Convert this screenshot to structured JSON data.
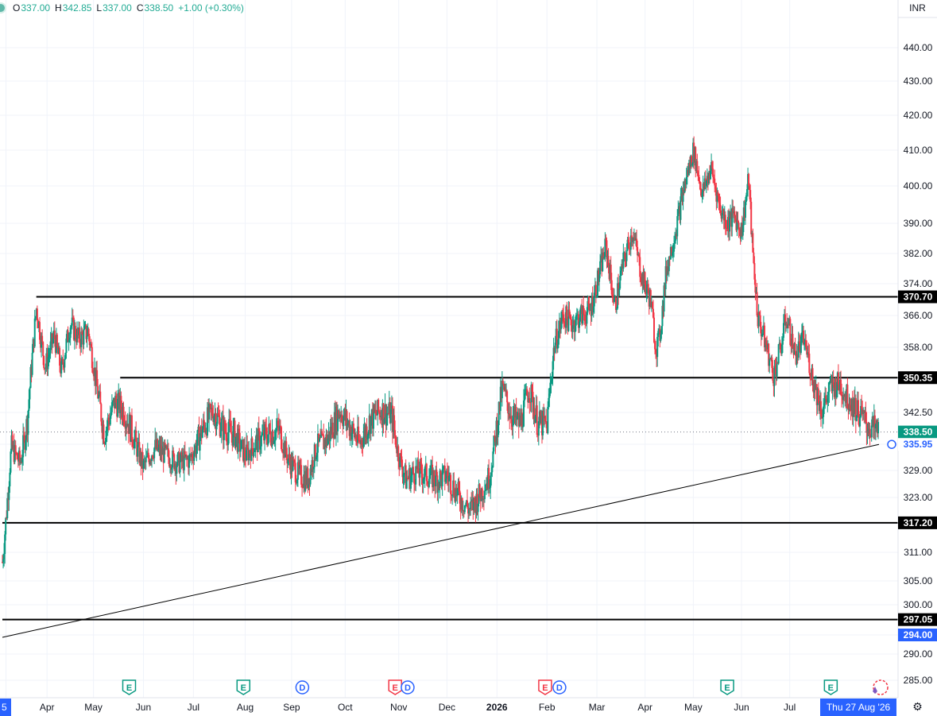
{
  "header": {
    "open_label": "O",
    "open": "337.00",
    "high_label": "H",
    "high": "342.85",
    "low_label": "L",
    "low": "337.00",
    "close_label": "C",
    "close": "338.50",
    "change": "+1.00 (+0.30%)"
  },
  "currency": "INR",
  "settings_icon": "gear-icon",
  "colors": {
    "up": "#089981",
    "down": "#f23645",
    "grid": "#f0f3fa",
    "axis": "#131722",
    "blue": "#2962ff",
    "header_up": "#22ab94"
  },
  "chart_data": {
    "type": "candlestick",
    "ylim": [
      281,
      449
    ],
    "y_ticks": [
      285,
      290,
      294,
      300,
      305,
      311,
      317,
      323,
      329,
      336,
      342.5,
      350,
      358,
      366,
      374,
      382,
      390,
      400,
      410,
      420,
      430,
      440
    ],
    "y_tick_labels": [
      "285.00",
      "290.00",
      "",
      "300.00",
      "305.00",
      "311.00",
      "",
      "323.00",
      "329.00",
      "",
      "342.50",
      "",
      "358.00",
      "366.00",
      "374.00",
      "382.00",
      "390.00",
      "400.00",
      "410.00",
      "420.00",
      "430.00",
      "440.00"
    ],
    "x_labels": [
      "5",
      "Apr",
      "May",
      "Jun",
      "Jul",
      "Aug",
      "Sep",
      "Oct",
      "Nov",
      "Dec",
      "2026",
      "Feb",
      "Mar",
      "Apr",
      "May",
      "Jun",
      "Jul"
    ],
    "x_label_bold": [
      false,
      false,
      false,
      false,
      false,
      false,
      false,
      false,
      false,
      false,
      true,
      false,
      false,
      false,
      false,
      false,
      false
    ],
    "x_label_pos": [
      0.2,
      2.5,
      5.1,
      7.9,
      10.7,
      13.6,
      16.2,
      19.2,
      22.2,
      24.9,
      27.7,
      30.5,
      33.3,
      36.0,
      38.7,
      41.4,
      44.1
    ],
    "x_months": 51.5,
    "horizontal_lines": [
      {
        "price": 370.7,
        "label": "370.70",
        "from": 1.9
      },
      {
        "price": 350.35,
        "label": "350.35",
        "from": 6.6
      },
      {
        "price": 317.2,
        "label": "317.20",
        "from": 0
      },
      {
        "price": 297.05,
        "label": "297.05",
        "from": 0
      }
    ],
    "trendline": {
      "from": [
        0,
        293.5
      ],
      "to": [
        49.1,
        335.95
      ]
    },
    "current_price": {
      "price": 338.5,
      "label": "338.50"
    },
    "trend_price_label": {
      "price": 335.95,
      "label": "335.95"
    },
    "crosshair_price_label": {
      "price": 294.0,
      "label": "294.00"
    },
    "crosshair_date": "Thu 27 Aug '26",
    "events": [
      {
        "x": 7.1,
        "type": "E",
        "color": "green"
      },
      {
        "x": 13.5,
        "type": "E",
        "color": "green"
      },
      {
        "x": 16.8,
        "type": "D",
        "color": "blue"
      },
      {
        "x": 22.0,
        "type": "E",
        "color": "red"
      },
      {
        "x": 22.7,
        "type": "D",
        "color": "blue"
      },
      {
        "x": 30.4,
        "type": "E",
        "color": "red"
      },
      {
        "x": 31.2,
        "type": "D",
        "color": "blue"
      },
      {
        "x": 40.6,
        "type": "E",
        "color": "green"
      },
      {
        "x": 46.4,
        "type": "E",
        "color": "green"
      }
    ],
    "anchors": [
      [
        0,
        309
      ],
      [
        0.2,
        318
      ],
      [
        0.5,
        335
      ],
      [
        1.0,
        331
      ],
      [
        1.4,
        341
      ],
      [
        1.7,
        357
      ],
      [
        1.9,
        368
      ],
      [
        2.4,
        353
      ],
      [
        2.9,
        361
      ],
      [
        3.3,
        352
      ],
      [
        3.8,
        364
      ],
      [
        4.3,
        360
      ],
      [
        4.8,
        362
      ],
      [
        5.3,
        348
      ],
      [
        5.7,
        338
      ],
      [
        6.3,
        345
      ],
      [
        6.8,
        343
      ],
      [
        7.3,
        338
      ],
      [
        7.9,
        330
      ],
      [
        8.5,
        335
      ],
      [
        9.2,
        333
      ],
      [
        9.8,
        331
      ],
      [
        10.5,
        332
      ],
      [
        11.2,
        339
      ],
      [
        11.8,
        343
      ],
      [
        12.4,
        339
      ],
      [
        13.0,
        338
      ],
      [
        13.6,
        333
      ],
      [
        14.2,
        336
      ],
      [
        14.8,
        338
      ],
      [
        15.5,
        339
      ],
      [
        16.0,
        332
      ],
      [
        16.6,
        328
      ],
      [
        17.1,
        327
      ],
      [
        17.6,
        335
      ],
      [
        18.2,
        337
      ],
      [
        18.9,
        343
      ],
      [
        19.4,
        340
      ],
      [
        20.0,
        336
      ],
      [
        20.6,
        341
      ],
      [
        21.2,
        343
      ],
      [
        21.8,
        342
      ],
      [
        22.2,
        333
      ],
      [
        22.6,
        327
      ],
      [
        23.2,
        329
      ],
      [
        23.8,
        328
      ],
      [
        24.4,
        327
      ],
      [
        24.9,
        328
      ],
      [
        25.6,
        323
      ],
      [
        26.2,
        320
      ],
      [
        26.8,
        324
      ],
      [
        27.3,
        328
      ],
      [
        27.7,
        340
      ],
      [
        28.0,
        348
      ],
      [
        28.5,
        342
      ],
      [
        29.0,
        340
      ],
      [
        29.5,
        348
      ],
      [
        30.0,
        340
      ],
      [
        30.5,
        340
      ],
      [
        30.9,
        358
      ],
      [
        31.4,
        366
      ],
      [
        31.9,
        364
      ],
      [
        32.4,
        366
      ],
      [
        32.9,
        367
      ],
      [
        33.3,
        374
      ],
      [
        33.8,
        384
      ],
      [
        34.3,
        368
      ],
      [
        34.8,
        380
      ],
      [
        35.3,
        388
      ],
      [
        35.8,
        376
      ],
      [
        36.3,
        370
      ],
      [
        36.6,
        358
      ],
      [
        36.8,
        360
      ],
      [
        37.2,
        378
      ],
      [
        37.7,
        388
      ],
      [
        38.2,
        400
      ],
      [
        38.7,
        410
      ],
      [
        39.2,
        398
      ],
      [
        39.7,
        405
      ],
      [
        40.2,
        394
      ],
      [
        40.6,
        390
      ],
      [
        41.0,
        392
      ],
      [
        41.4,
        388
      ],
      [
        41.8,
        402
      ],
      [
        42.0,
        384
      ],
      [
        42.3,
        366
      ],
      [
        42.8,
        358
      ],
      [
        43.2,
        351
      ],
      [
        43.6,
        358
      ],
      [
        43.9,
        366
      ],
      [
        44.4,
        356
      ],
      [
        44.9,
        360
      ],
      [
        45.4,
        350
      ],
      [
        45.9,
        343
      ],
      [
        46.4,
        348
      ],
      [
        46.9,
        349
      ],
      [
        47.3,
        346
      ],
      [
        47.9,
        343
      ],
      [
        48.4,
        340
      ],
      [
        48.8,
        339
      ],
      [
        49.1,
        338.5
      ]
    ]
  }
}
